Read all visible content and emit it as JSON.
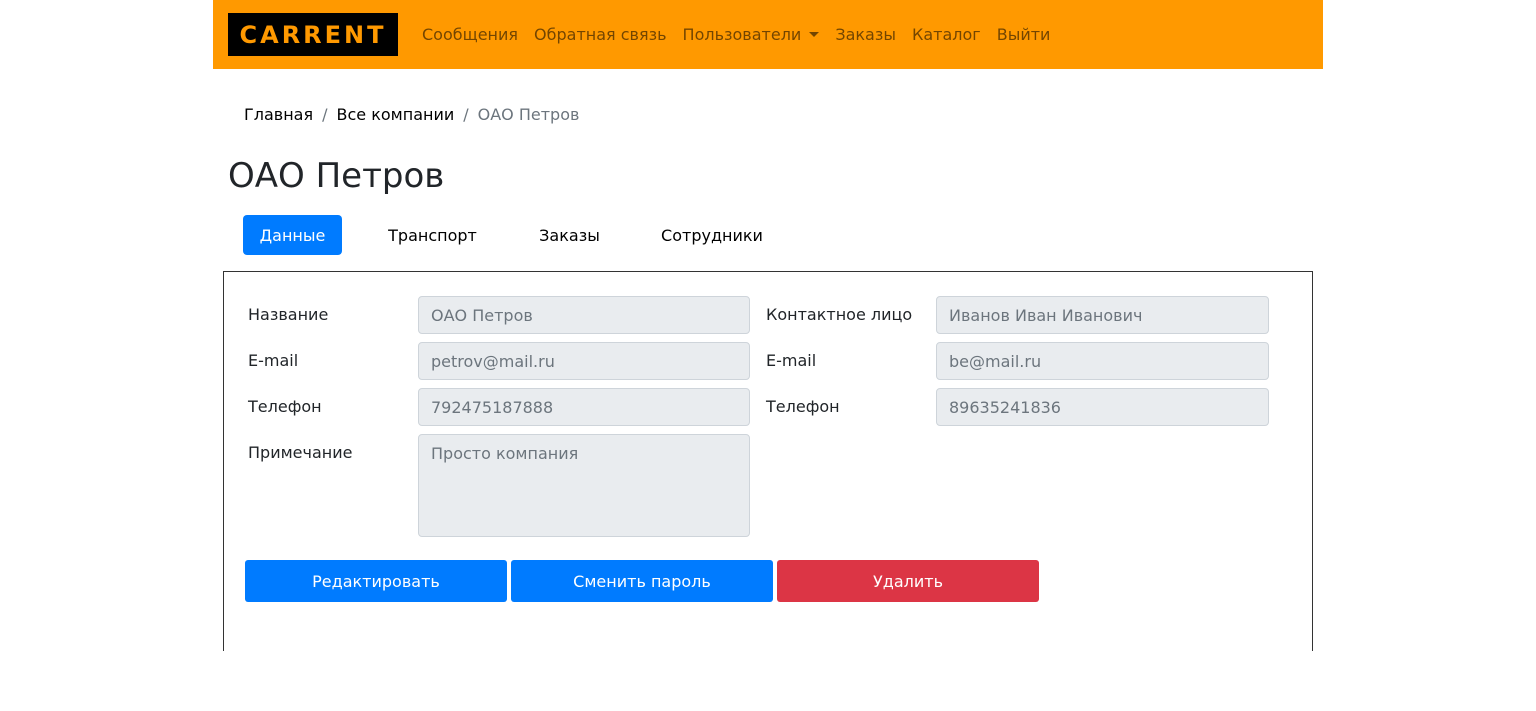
{
  "brand": {
    "logo_text": "CARRENT"
  },
  "nav": {
    "messages": "Сообщения",
    "feedback": "Обратная связь",
    "users": "Пользователи",
    "orders": "Заказы",
    "catalog": "Каталог",
    "logout": "Выйти"
  },
  "breadcrumb": {
    "home": "Главная",
    "companies": "Все компании",
    "current": "ОАО Петров",
    "separator": "/"
  },
  "page": {
    "title": "ОАО Петров"
  },
  "tabs": {
    "data": "Данные",
    "transport": "Транспорт",
    "orders": "Заказы",
    "employees": "Сотрудники"
  },
  "company": {
    "name_label": "Название",
    "name_value": "ОАО Петров",
    "email_label": "E-mail",
    "email_value": "petrov@mail.ru",
    "phone_label": "Телефон",
    "phone_value": "792475187888",
    "note_label": "Примечание",
    "note_value": "Просто компания"
  },
  "contact": {
    "person_label": "Контактное лицо",
    "person_value": "Иванов Иван Иванович",
    "email_label": "E-mail",
    "email_value": "be@mail.ru",
    "phone_label": "Телефон",
    "phone_value": "89635241836"
  },
  "actions": {
    "edit": "Редактировать",
    "change_password": "Сменить пароль",
    "delete": "Удалить"
  },
  "colors": {
    "navbar": "#ff9900",
    "primary": "#007bff",
    "danger": "#dc3545",
    "field_bg": "#e9ecef"
  }
}
